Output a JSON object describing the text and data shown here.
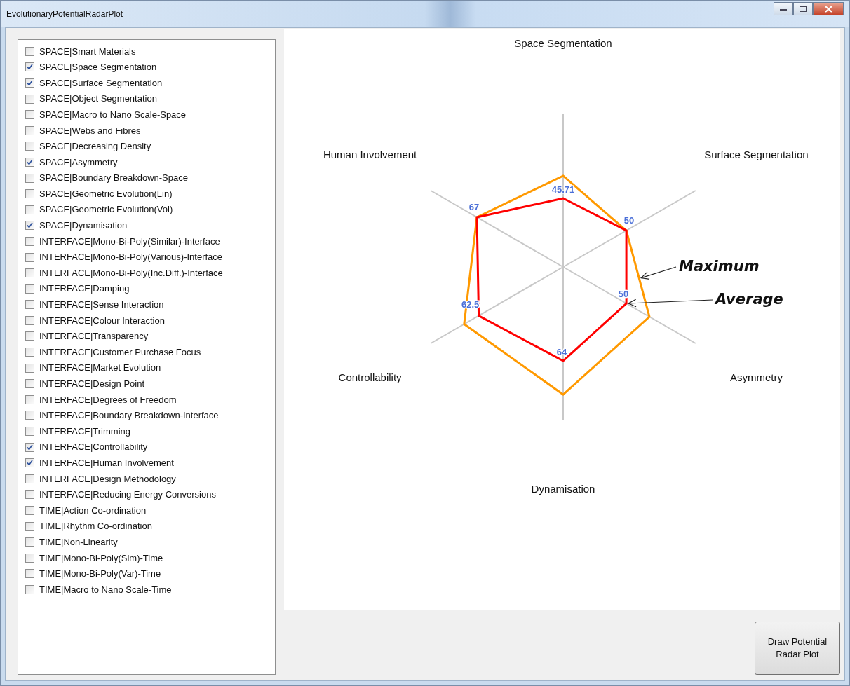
{
  "window": {
    "title": "EvolutionaryPotentialRadarPlot"
  },
  "checklist": [
    {
      "label": "SPACE|Smart Materials",
      "checked": false
    },
    {
      "label": "SPACE|Space Segmentation",
      "checked": true
    },
    {
      "label": "SPACE|Surface Segmentation",
      "checked": true
    },
    {
      "label": "SPACE|Object Segmentation",
      "checked": false
    },
    {
      "label": "SPACE|Macro to Nano Scale-Space",
      "checked": false
    },
    {
      "label": "SPACE|Webs and Fibres",
      "checked": false
    },
    {
      "label": "SPACE|Decreasing Density",
      "checked": false
    },
    {
      "label": "SPACE|Asymmetry",
      "checked": true
    },
    {
      "label": "SPACE|Boundary Breakdown-Space",
      "checked": false
    },
    {
      "label": "SPACE|Geometric Evolution(Lin)",
      "checked": false
    },
    {
      "label": "SPACE|Geometric Evolution(Vol)",
      "checked": false
    },
    {
      "label": "SPACE|Dynamisation",
      "checked": true
    },
    {
      "label": "INTERFACE|Mono-Bi-Poly(Similar)-Interface",
      "checked": false
    },
    {
      "label": "INTERFACE|Mono-Bi-Poly(Various)-Interface",
      "checked": false
    },
    {
      "label": "INTERFACE|Mono-Bi-Poly(Inc.Diff.)-Interface",
      "checked": false
    },
    {
      "label": "INTERFACE|Damping",
      "checked": false
    },
    {
      "label": "INTERFACE|Sense Interaction",
      "checked": false
    },
    {
      "label": "INTERFACE|Colour Interaction",
      "checked": false
    },
    {
      "label": "INTERFACE|Transparency",
      "checked": false
    },
    {
      "label": "INTERFACE|Customer Purchase Focus",
      "checked": false
    },
    {
      "label": "INTERFACE|Market Evolution",
      "checked": false
    },
    {
      "label": "INTERFACE|Design Point",
      "checked": false
    },
    {
      "label": "INTERFACE|Degrees of Freedom",
      "checked": false
    },
    {
      "label": "INTERFACE|Boundary Breakdown-Interface",
      "checked": false
    },
    {
      "label": "INTERFACE|Trimming",
      "checked": false
    },
    {
      "label": "INTERFACE|Controllability",
      "checked": true
    },
    {
      "label": "INTERFACE|Human Involvement",
      "checked": true
    },
    {
      "label": "INTERFACE|Design Methodology",
      "checked": false
    },
    {
      "label": "INTERFACE|Reducing Energy Conversions",
      "checked": false
    },
    {
      "label": "TIME|Action Co-ordination",
      "checked": false
    },
    {
      "label": "TIME|Rhythm Co-ordination",
      "checked": false
    },
    {
      "label": "TIME|Non-Linearity",
      "checked": false
    },
    {
      "label": "TIME|Mono-Bi-Poly(Sim)-Time",
      "checked": false
    },
    {
      "label": "TIME|Mono-Bi-Poly(Var)-Time",
      "checked": false
    },
    {
      "label": "TIME|Macro to Nano Scale-Time",
      "checked": false
    }
  ],
  "chart": {
    "axis_labels": [
      "Space Segmentation",
      "Surface Segmentation",
      "Asymmetry",
      "Dynamisation",
      "Controllability",
      "Human Involvement"
    ],
    "value_labels": [
      "45.71",
      "50",
      "50",
      "64",
      "62.5",
      "67"
    ],
    "annotations": [
      "Maximum",
      "Average"
    ]
  },
  "button": {
    "label": "Draw Potential Radar Plot"
  }
}
